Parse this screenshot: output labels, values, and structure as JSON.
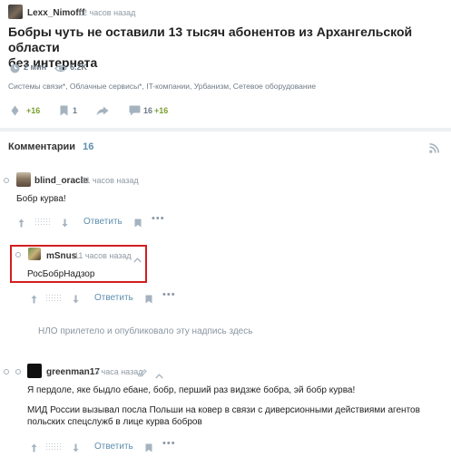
{
  "post": {
    "author": "Lexx_Nimofff",
    "time": "12 часов назад",
    "title_line1": "Бобры чуть не оставили 13 тысяч абонентов из Архангельской области",
    "title_line2": "без интернета",
    "read_time": "2 мин",
    "views": "6.2K",
    "hubs": "Системы связи*, Облачные сервисы*, IT-компании, Урбанизм, Сетевое оборудование",
    "rating": "+16",
    "bookmarks": "1",
    "comments_count": "16",
    "comments_new": "+16"
  },
  "comments_section": {
    "title": "Комментарии",
    "count": "16"
  },
  "comments": [
    {
      "author": "blind_oracle",
      "time": "11 часов назад",
      "text": "Бобр курва!",
      "reply_label": "Ответить"
    },
    {
      "author": "mSnus",
      "time": "11 часов назад",
      "text": "РосБобрНадзор",
      "reply_label": "Ответить"
    },
    {
      "author": "greenman17",
      "time": "3 часа назад",
      "text_line1": "Я пердоле, яке быдло ебане, бобр, перший раз видзже бобра, эй бобр курва!",
      "text_line2": "МИД России вызывал посла Польши на ковер в связи с диверсионными действиями агентов",
      "text_line3": "польских спецслужб в лице курва бобров",
      "reply_label": "Ответить"
    }
  ],
  "ufo_notice": "НЛО прилетело и опубликовало эту надпись здесь",
  "colors": {
    "accent": "#5e8eac",
    "green": "#7b9e31",
    "highlight_border": "#d21e1e",
    "icon": "#a5b3bf"
  }
}
